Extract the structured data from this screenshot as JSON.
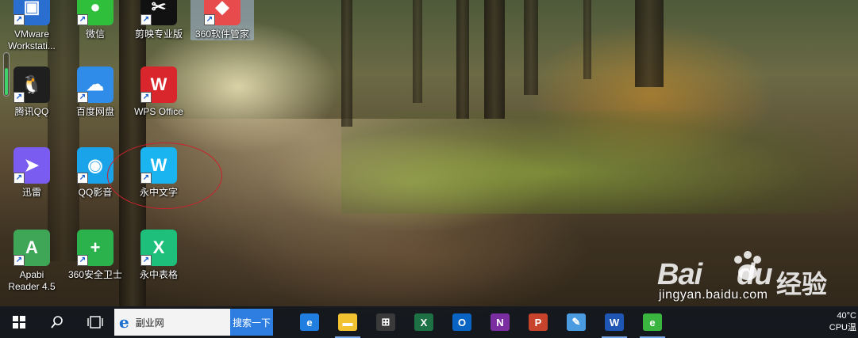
{
  "desktop": {
    "icons": [
      {
        "label": "VMware\nWorkstati...",
        "name": "vmware-workstation",
        "color": "#2a6ecf",
        "glyph": "▣"
      },
      {
        "label": "微信",
        "name": "wechat",
        "color": "#2fbf3b",
        "glyph": "●"
      },
      {
        "label": "剪映专业版",
        "name": "jianying-pro",
        "color": "#111111",
        "glyph": "✂"
      },
      {
        "label": "360软件管家",
        "name": "360-software-manager",
        "color": "#e84b4b",
        "glyph": "◆"
      },
      {
        "label": "腾讯QQ",
        "name": "tencent-qq",
        "color": "#1f1f1f",
        "glyph": "🐧"
      },
      {
        "label": "百度网盘",
        "name": "baidu-netdisk",
        "color": "#2f8ce8",
        "glyph": "☁"
      },
      {
        "label": "WPS Office",
        "name": "wps-office",
        "color": "#d8262c",
        "glyph": "W"
      },
      {
        "label": "迅雷",
        "name": "xunlei",
        "color": "#7b5cf0",
        "glyph": "➤"
      },
      {
        "label": "QQ影音",
        "name": "qq-player",
        "color": "#1aa3e8",
        "glyph": "◉"
      },
      {
        "label": "永中文字",
        "name": "yozo-writer",
        "color": "#1ab4f0",
        "glyph": "W"
      },
      {
        "label": "Apabi\nReader 4.5",
        "name": "apabi-reader",
        "color": "#3fa657",
        "glyph": "A"
      },
      {
        "label": "360安全卫士",
        "name": "360-security-guard",
        "color": "#2bb24c",
        "glyph": "+"
      },
      {
        "label": "永中表格",
        "name": "yozo-spreadsheet",
        "color": "#1dbf7a",
        "glyph": "X"
      }
    ]
  },
  "watermark": {
    "logo_bai": "Bai",
    "logo_du": "du",
    "logo_cn": "经验",
    "url": "jingyan.baidu.com"
  },
  "taskbar": {
    "search_text": "副业网",
    "search_button": "搜索一下",
    "apps": [
      {
        "name": "edge",
        "glyph": "e",
        "color": "#1f7ee0"
      },
      {
        "name": "file-explorer",
        "glyph": "▬",
        "color": "#f2c230"
      },
      {
        "name": "microsoft-store",
        "glyph": "⊞",
        "color": "#3a3a3a"
      },
      {
        "name": "excel",
        "glyph": "X",
        "color": "#1e7145"
      },
      {
        "name": "outlook",
        "glyph": "O",
        "color": "#0a64c4"
      },
      {
        "name": "onenote",
        "glyph": "N",
        "color": "#7a2ea0"
      },
      {
        "name": "powerpoint",
        "glyph": "P",
        "color": "#c8432b"
      },
      {
        "name": "paint",
        "glyph": "✎",
        "color": "#4b9be0"
      },
      {
        "name": "word",
        "glyph": "W",
        "color": "#1f56b3"
      },
      {
        "name": "360-browser",
        "glyph": "e",
        "color": "#3ab540"
      }
    ],
    "tray_temp": "40°C",
    "tray_cpu": "CPU温"
  }
}
